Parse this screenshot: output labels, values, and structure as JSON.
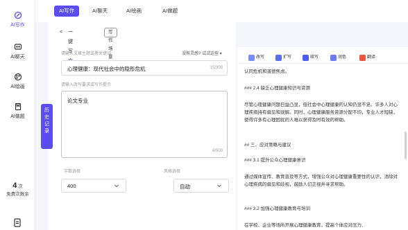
{
  "rail": {
    "items": [
      {
        "label": "AI写作",
        "active": true
      },
      {
        "label": "AI聊天"
      },
      {
        "label": "AI绘画"
      },
      {
        "label": "AI做题"
      }
    ],
    "quota_num": "4",
    "quota_unit": "次",
    "quota_label": "免费次数余"
  },
  "tabs": [
    {
      "label": "AI写作",
      "active": true
    },
    {
      "label": "AI聊天"
    },
    {
      "label": "AI绘画"
    },
    {
      "label": "AI做题"
    }
  ],
  "editor": {
    "back_glyph": "<",
    "subtitle": "一键写文",
    "switch_label": "写作场景切换",
    "title_label": "请输入文章主题或者关键词",
    "title_link": "没有灵感? 试试这些 ▾",
    "title_value": "心理健康：现代社会中的隐形危机",
    "title_count": "15/300",
    "req_label": "请输入改写要求或写作提示",
    "req_value": "论文专业",
    "req_count": "4/500",
    "wordcount_label": "字数选择",
    "wordcount_value": "400",
    "style_label": "风格选择",
    "style_value": "自动"
  },
  "history": {
    "label": "历史记录"
  },
  "toolbar": {
    "items": [
      {
        "label": "改写",
        "color": "#7a8cf5"
      },
      {
        "label": "扩写",
        "color": "#5b6cf0"
      },
      {
        "label": "续写",
        "color": "#4e5df0"
      },
      {
        "label": "润色",
        "color": "#6f7df2"
      },
      {
        "label": "翻译",
        "color": "#e9543f"
      }
    ]
  },
  "output": {
    "paragraphs": [
      "认同危机和道德焦虑。",
      "### 2.4 缺乏心理健康知识与资源",
      "尽管心理健康问题日益凸显，但社会中心理健康的认知仍显不足。许多人对心理疾病持有偏见和误解。同时，心理健康服务资源分配不均，专业人才短缺，使得许多有心理困扰的人难以获得及时有效的帮助。",
      "## 三、应对策略与建议",
      "### 3.1 提升公众心理健康意识",
      "通过媒体宣传、教育普及等方式，增强公众对心理健康重要性的认识，消除对心理疾病的偏见和歧视，鼓励人们正视并寻求帮助。",
      "### 3.2 加强心理健康教育与培训",
      "在学校、企业等场所开展心理健康教育，提高个体应对压力、"
    ]
  }
}
